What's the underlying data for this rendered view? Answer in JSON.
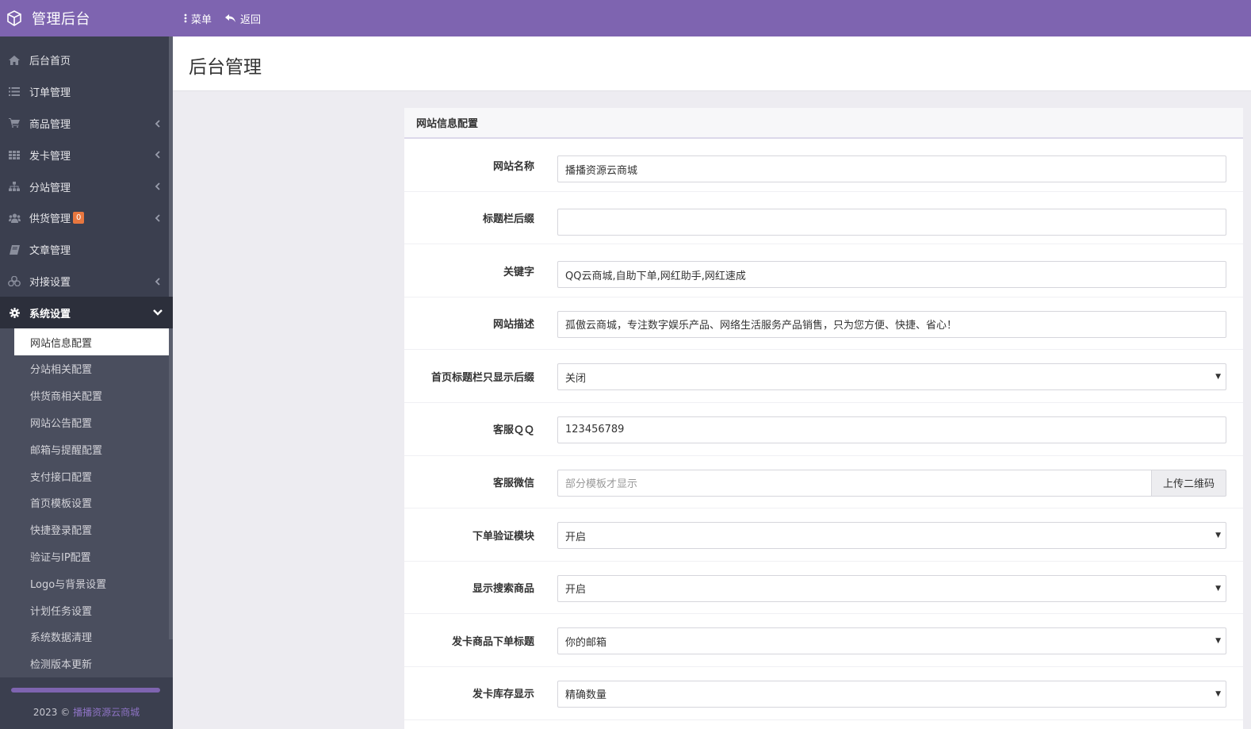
{
  "app": {
    "title": "管理后台",
    "menu_label": "菜单",
    "back_label": "返回"
  },
  "sidebar": {
    "items": [
      {
        "label": "后台首页",
        "icon": "home-icon"
      },
      {
        "label": "订单管理",
        "icon": "list-icon"
      },
      {
        "label": "商品管理",
        "icon": "cart-icon"
      },
      {
        "label": "发卡管理",
        "icon": "grid-icon"
      },
      {
        "label": "分站管理",
        "icon": "sitemap-icon"
      },
      {
        "label": "供货管理",
        "icon": "users-icon",
        "badge": "0"
      },
      {
        "label": "文章管理",
        "icon": "book-icon"
      },
      {
        "label": "对接设置",
        "icon": "cubes-icon"
      },
      {
        "label": "系统设置",
        "icon": "gear-icon"
      }
    ],
    "submenu": [
      "网站信息配置",
      "分站相关配置",
      "供货商相关配置",
      "网站公告配置",
      "邮箱与提醒配置",
      "支付接口配置",
      "首页模板设置",
      "快捷登录配置",
      "验证与IP配置",
      "Logo与背景设置",
      "计划任务设置",
      "系统数据清理",
      "检测版本更新"
    ],
    "footer_year": "2023 ©",
    "footer_link": "播播资源云商城"
  },
  "page": {
    "title": "后台管理"
  },
  "panel": {
    "heading": "网站信息配置",
    "fields": {
      "site_name": {
        "label": "网站名称",
        "value": "播播资源云商城"
      },
      "title_suffix": {
        "label": "标题栏后缀",
        "value": ""
      },
      "keywords": {
        "label": "关键字",
        "value": "QQ云商城,自助下单,网红助手,网红速成"
      },
      "description": {
        "label": "网站描述",
        "value": "孤傲云商城，专注数字娱乐产品、网络生活服务产品销售，只为您方便、快捷、省心！"
      },
      "home_suffix_only": {
        "label": "首页标题栏只显示后缀",
        "value": "关闭"
      },
      "service_qq": {
        "label": "客服ＱＱ",
        "value": "123456789"
      },
      "service_wechat": {
        "label": "客服微信",
        "placeholder": "部分模板才显示",
        "button": "上传二维码"
      },
      "order_verify": {
        "label": "下单验证模块",
        "value": "开启"
      },
      "show_search": {
        "label": "显示搜索商品",
        "value": "开启"
      },
      "card_order_title": {
        "label": "发卡商品下单标题",
        "value": "你的邮箱"
      },
      "card_stock_display": {
        "label": "发卡库存显示",
        "value": "精确数量"
      }
    }
  }
}
